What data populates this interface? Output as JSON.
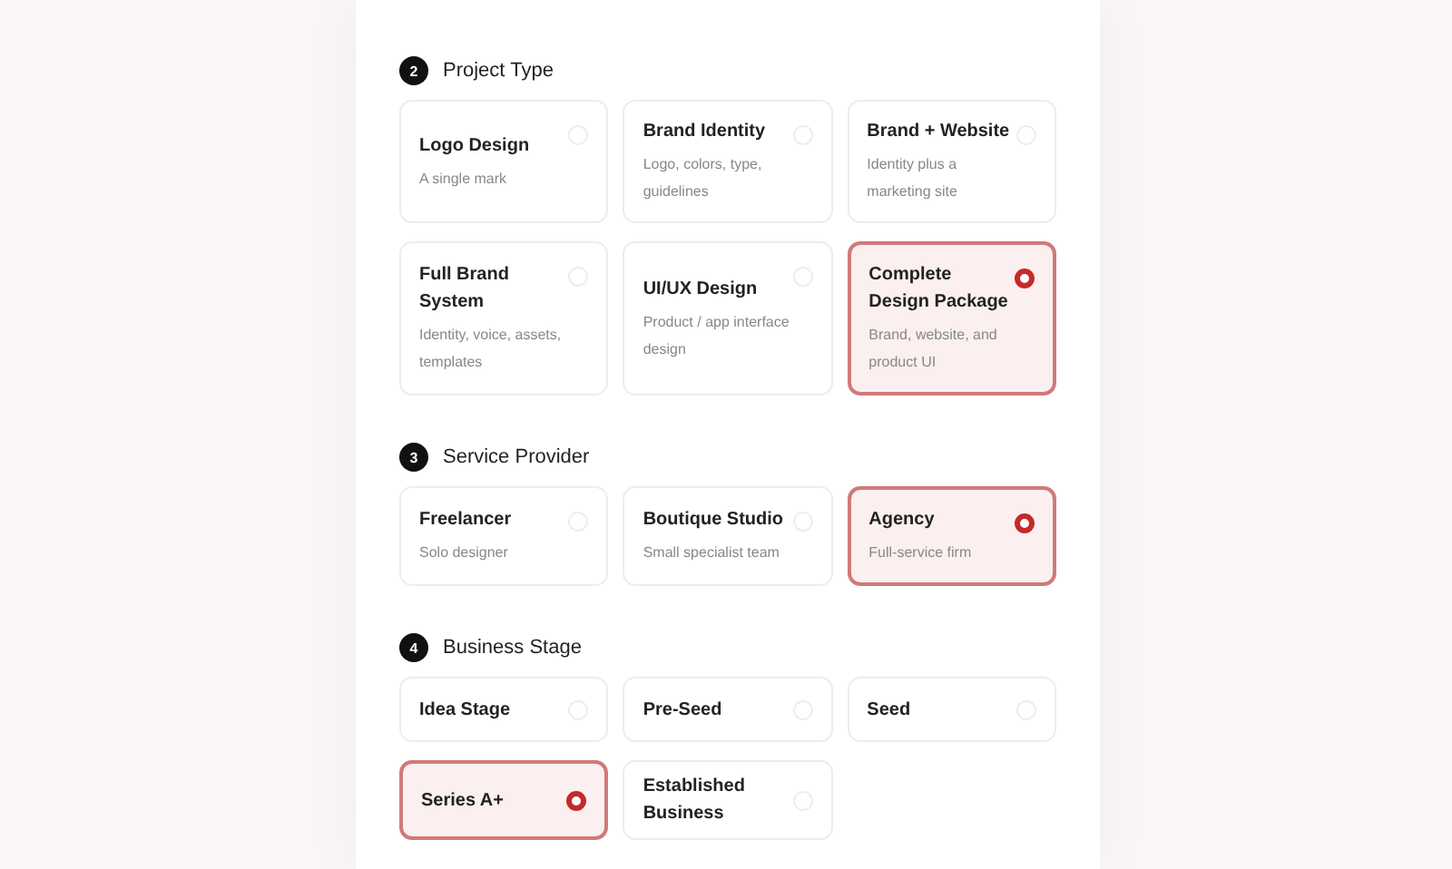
{
  "sections": [
    {
      "number": "2",
      "title": "Project Type",
      "options": [
        {
          "title": "Logo Design",
          "description": "A single mark",
          "selected": false
        },
        {
          "title": "Brand Identity",
          "description": "Logo, colors, type, guidelines",
          "selected": false
        },
        {
          "title": "Brand + Website",
          "description": "Identity plus a marketing site",
          "selected": false
        },
        {
          "title": "Full Brand System",
          "description": "Identity, voice, assets, templates",
          "selected": false
        },
        {
          "title": "UI/UX Design",
          "description": "Product / app interface design",
          "selected": false
        },
        {
          "title": "Complete Design Package",
          "description": "Brand, website, and product UI",
          "selected": true
        }
      ]
    },
    {
      "number": "3",
      "title": "Service Provider",
      "options": [
        {
          "title": "Freelancer",
          "description": "Solo designer",
          "selected": false
        },
        {
          "title": "Boutique Studio",
          "description": "Small specialist team",
          "selected": false
        },
        {
          "title": "Agency",
          "description": "Full-service firm",
          "selected": true
        }
      ]
    },
    {
      "number": "4",
      "title": "Business Stage",
      "options": [
        {
          "title": "Idea Stage",
          "selected": false
        },
        {
          "title": "Pre-Seed",
          "selected": false
        },
        {
          "title": "Seed",
          "selected": false
        },
        {
          "title": "Series A+",
          "selected": true
        },
        {
          "title": "Established Business",
          "selected": false
        }
      ]
    }
  ]
}
